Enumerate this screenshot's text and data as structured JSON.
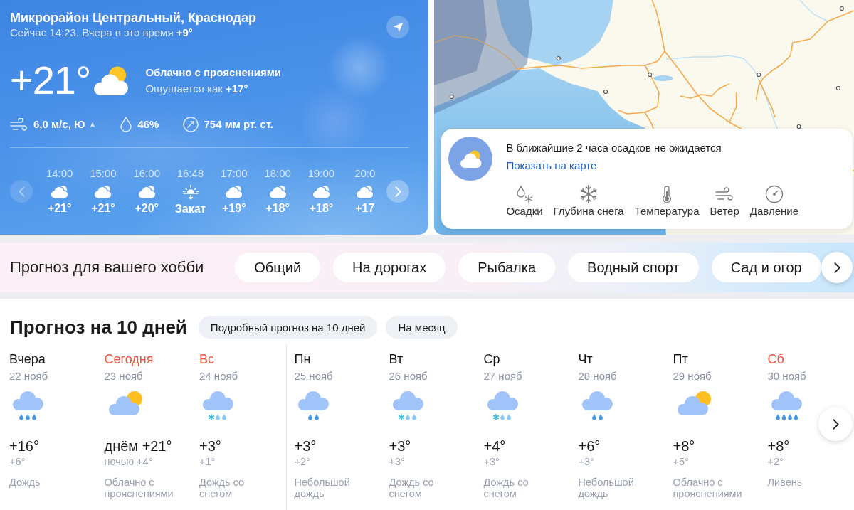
{
  "current": {
    "location": "Микрорайон Центральный, Краснодар",
    "subtitle": "Сейчас 14:23. Вчера в это время **+9°**",
    "temperature": "+21°",
    "condition": "Облачно с прояснениями",
    "feels_like": "Ощущается как **+17°**",
    "stats": [
      {
        "kind": "wind",
        "value": "6,0 м/с, Ю"
      },
      {
        "kind": "humidity",
        "value": "46%"
      },
      {
        "kind": "pressure",
        "value": "754 мм рт. ст."
      }
    ]
  },
  "hourly": {
    "prev_disabled": true,
    "next_disabled": false,
    "items": [
      {
        "kind": "hour",
        "time": "14:00",
        "temp": "+21°"
      },
      {
        "kind": "hour",
        "time": "15:00",
        "temp": "+21°"
      },
      {
        "kind": "hour",
        "time": "16:00",
        "temp": "+20°"
      },
      {
        "kind": "sunset",
        "time": "16:48",
        "temp": "Закат"
      },
      {
        "kind": "hour",
        "time": "17:00",
        "temp": "+19°"
      },
      {
        "kind": "hour",
        "time": "18:00",
        "temp": "+18°"
      },
      {
        "kind": "hour",
        "time": "19:00",
        "temp": "+18°"
      },
      {
        "kind": "hour",
        "time": "20:0",
        "temp": "+17"
      }
    ]
  },
  "nowcast": {
    "message": "В ближайшие 2 часа осадков не ожидается",
    "link": "Показать на карте",
    "layers": [
      {
        "kind": "precipitation",
        "label": "Осадки"
      },
      {
        "kind": "snow",
        "label": "Глубина снега"
      },
      {
        "kind": "temperature",
        "label": "Температура"
      },
      {
        "kind": "wind",
        "label": "Ветер"
      },
      {
        "kind": "pressure",
        "label": "Давление"
      }
    ]
  },
  "hobby": {
    "title": "Прогноз для вашего хобби",
    "chips": [
      "Общий",
      "На дорогах",
      "Рыбалка",
      "Водный спорт",
      "Сад и огор"
    ]
  },
  "forecast": {
    "title": "Прогноз на 10 дней",
    "buttons": [
      "Подробный прогноз на 10 дней",
      "На месяц"
    ],
    "weeks": [
      {
        "days": [
          {
            "name": "Вчера",
            "date": "22 нояб",
            "weekend": false,
            "kind": "rain",
            "day_temp": "+16°",
            "night_temp": "+6°",
            "condition": "Дождь"
          },
          {
            "name": "Сегодня",
            "date": "23 нояб",
            "weekend": true,
            "kind": "partly_cloudy",
            "day_temp": "днём +21°",
            "night_temp": "ночью +4°",
            "condition": "Облачно с прояснениями"
          },
          {
            "name": "Вс",
            "date": "24 нояб",
            "weekend": true,
            "kind": "sleet",
            "day_temp": "+3°",
            "night_temp": "+1°",
            "condition": "Дождь со снегом"
          }
        ]
      },
      {
        "days": [
          {
            "name": "Пн",
            "date": "25 нояб",
            "weekend": false,
            "kind": "light_rain",
            "day_temp": "+3°",
            "night_temp": "+2°",
            "condition": "Небольшой дождь"
          },
          {
            "name": "Вт",
            "date": "26 нояб",
            "weekend": false,
            "kind": "sleet",
            "day_temp": "+3°",
            "night_temp": "+3°",
            "condition": "Дождь со снегом"
          },
          {
            "name": "Ср",
            "date": "27 нояб",
            "weekend": false,
            "kind": "sleet",
            "day_temp": "+4°",
            "night_temp": "+3°",
            "condition": "Дождь со снегом"
          },
          {
            "name": "Чт",
            "date": "28 нояб",
            "weekend": false,
            "kind": "light_rain",
            "day_temp": "+6°",
            "night_temp": "+3°",
            "condition": "Небольшой дождь"
          },
          {
            "name": "Пт",
            "date": "29 нояб",
            "weekend": false,
            "kind": "partly_cloudy",
            "day_temp": "+8°",
            "night_temp": "+5°",
            "condition": "Облачно с прояснениями"
          },
          {
            "name": "Сб",
            "date": "30 нояб",
            "weekend": true,
            "kind": "shower",
            "day_temp": "+8°",
            "night_temp": "+2°",
            "condition": "Ливень"
          }
        ]
      }
    ]
  }
}
